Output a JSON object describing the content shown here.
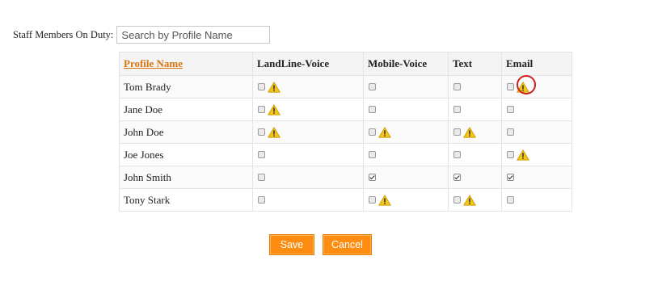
{
  "search": {
    "label": "Staff Members On Duty:",
    "placeholder": "Search by Profile Name",
    "value": ""
  },
  "table": {
    "headers": {
      "profile_name": "Profile Name",
      "landline": "LandLine-Voice",
      "mobile": "Mobile-Voice",
      "text": "Text",
      "email": "Email"
    },
    "rows": [
      {
        "name": "Tom Brady",
        "landline": {
          "checked": false,
          "warning": true
        },
        "mobile": {
          "checked": false,
          "warning": false
        },
        "text": {
          "checked": false,
          "warning": false
        },
        "email": {
          "checked": false,
          "warning": true,
          "highlighted": true
        }
      },
      {
        "name": "Jane Doe",
        "landline": {
          "checked": false,
          "warning": true
        },
        "mobile": {
          "checked": false,
          "warning": false
        },
        "text": {
          "checked": false,
          "warning": false
        },
        "email": {
          "checked": false,
          "warning": false
        }
      },
      {
        "name": "John Doe",
        "landline": {
          "checked": false,
          "warning": true
        },
        "mobile": {
          "checked": false,
          "warning": true
        },
        "text": {
          "checked": false,
          "warning": true
        },
        "email": {
          "checked": false,
          "warning": false
        }
      },
      {
        "name": "Joe Jones",
        "landline": {
          "checked": false,
          "warning": false
        },
        "mobile": {
          "checked": false,
          "warning": false
        },
        "text": {
          "checked": false,
          "warning": false
        },
        "email": {
          "checked": false,
          "warning": true
        }
      },
      {
        "name": "John Smith",
        "landline": {
          "checked": false,
          "warning": false
        },
        "mobile": {
          "checked": true,
          "warning": false
        },
        "text": {
          "checked": true,
          "warning": false
        },
        "email": {
          "checked": true,
          "warning": false
        }
      },
      {
        "name": "Tony Stark",
        "landline": {
          "checked": false,
          "warning": false
        },
        "mobile": {
          "checked": false,
          "warning": true
        },
        "text": {
          "checked": false,
          "warning": true
        },
        "email": {
          "checked": false,
          "warning": false
        }
      }
    ]
  },
  "buttons": {
    "save": "Save",
    "cancel": "Cancel"
  },
  "colors": {
    "accent": "#fd8c10",
    "header_link": "#d9750e",
    "warning_fill": "#f5c518",
    "highlight_ring": "#cc1f1f"
  },
  "icons": {
    "warning": "warning-triangle-icon"
  }
}
